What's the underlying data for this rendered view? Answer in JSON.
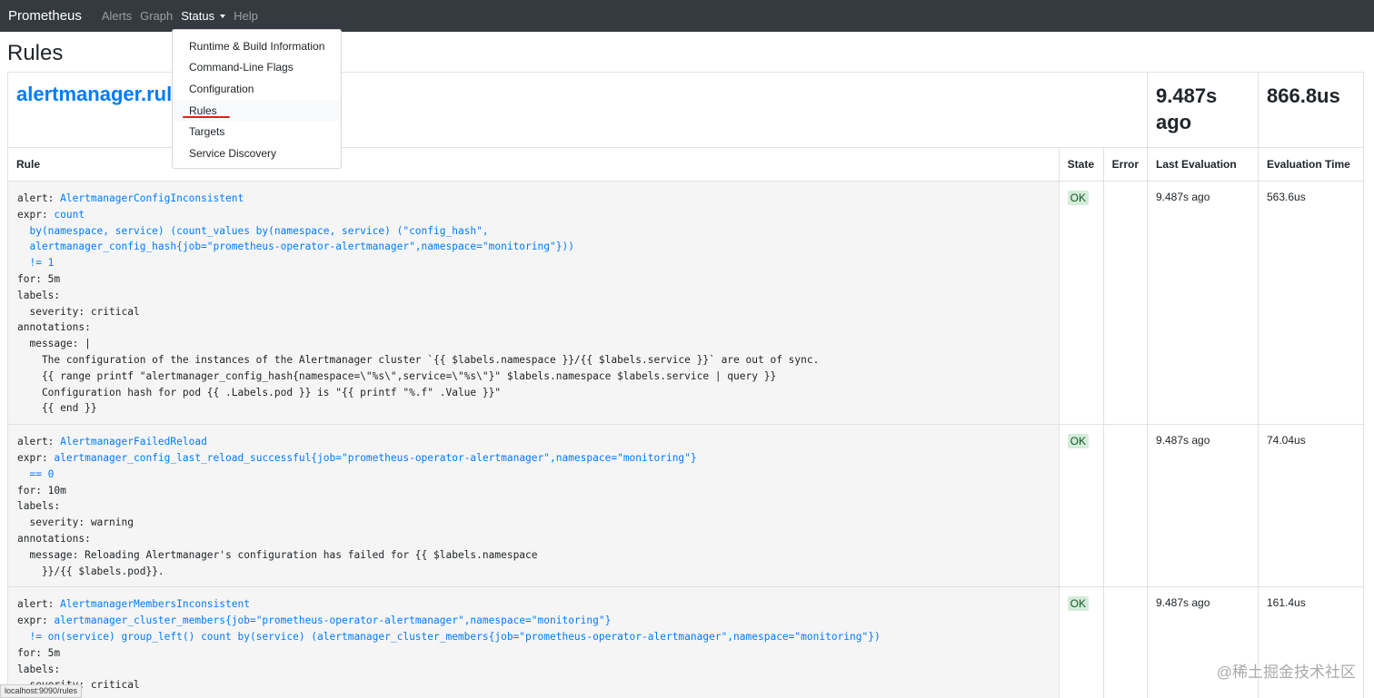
{
  "navbar": {
    "brand": "Prometheus",
    "items": [
      "Alerts",
      "Graph",
      "Status",
      "Help"
    ]
  },
  "page_title": "Rules",
  "group": {
    "name": "alertmanager.rules",
    "last_evaluation": "9.487s ago",
    "evaluation_time": "866.8us"
  },
  "table_headers": {
    "rule": "Rule",
    "state": "State",
    "error": "Error",
    "last_evaluation": "Last Evaluation",
    "evaluation_time": "Evaluation Time"
  },
  "rules": [
    {
      "alert_key": "alert: ",
      "alert_name": "AlertmanagerConfigInconsistent",
      "expr_key": "expr: ",
      "expr": "count\n  by(namespace, service) (count_values by(namespace, service) (\"config_hash\",\n  alertmanager_config_hash{job=\"prometheus-operator-alertmanager\",namespace=\"monitoring\"}))\n  != 1",
      "rest": "for: 5m\nlabels:\n  severity: critical\nannotations:\n  message: |\n    The configuration of the instances of the Alertmanager cluster `{{ $labels.namespace }}/{{ $labels.service }}` are out of sync.\n    {{ range printf \"alertmanager_config_hash{namespace=\\\"%s\\\",service=\\\"%s\\\"}\" $labels.namespace $labels.service | query }}\n    Configuration hash for pod {{ .Labels.pod }} is \"{{ printf \"%.f\" .Value }}\"\n    {{ end }}",
      "state": "OK",
      "error": "",
      "last_evaluation": "9.487s ago",
      "evaluation_time": "563.6us"
    },
    {
      "alert_key": "alert: ",
      "alert_name": "AlertmanagerFailedReload",
      "expr_key": "expr: ",
      "expr": "alertmanager_config_last_reload_successful{job=\"prometheus-operator-alertmanager\",namespace=\"monitoring\"}\n  == 0",
      "rest": "for: 10m\nlabels:\n  severity: warning\nannotations:\n  message: Reloading Alertmanager's configuration has failed for {{ $labels.namespace\n    }}/{{ $labels.pod}}.",
      "state": "OK",
      "error": "",
      "last_evaluation": "9.487s ago",
      "evaluation_time": "74.04us"
    },
    {
      "alert_key": "alert: ",
      "alert_name": "AlertmanagerMembersInconsistent",
      "expr_key": "expr: ",
      "expr": "alertmanager_cluster_members{job=\"prometheus-operator-alertmanager\",namespace=\"monitoring\"}\n  != on(service) group_left() count by(service) (alertmanager_cluster_members{job=\"prometheus-operator-alertmanager\",namespace=\"monitoring\"})",
      "rest": "for: 5m\nlabels:\n  severity: critical",
      "state": "OK",
      "error": "",
      "last_evaluation": "9.487s ago",
      "evaluation_time": "161.4us"
    }
  ],
  "status_dropdown": [
    "Runtime & Build Information",
    "Command-Line Flags",
    "Configuration",
    "Rules",
    "Targets",
    "Service Discovery"
  ],
  "status_bar": "localhost:9090/rules",
  "watermark": "@稀土掘金技术社区"
}
